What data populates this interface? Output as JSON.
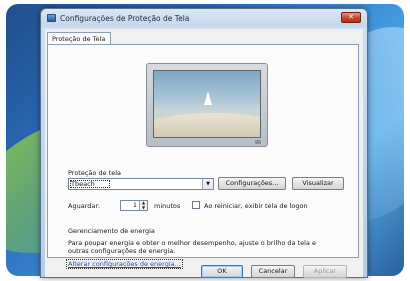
{
  "window": {
    "title": "Configurações de Proteção de Tela",
    "close_glyph": "✕"
  },
  "tabs": [
    {
      "label": "Proteção de Tela"
    }
  ],
  "screensaver": {
    "section_label": "Proteção de tela",
    "selected": "Tbeach",
    "settings_button": "Configurações...",
    "preview_button": "Visualizar",
    "wait_label": "Aguardar:",
    "wait_value": "1",
    "minutes_label": "minutos",
    "resume_checkbox_label": "Ao reiniciar, exibir tela de logon",
    "resume_checked": false
  },
  "power": {
    "section_label": "Gerenciamento de energia",
    "description": "Para poupar energia e obter o melhor desempenho, ajuste o brilho da tela e outras configurações de energia.",
    "link": "Alterar configurações de energia..."
  },
  "footer": {
    "ok": "OK",
    "cancel": "Cancelar",
    "apply": "Aplicar"
  },
  "icons": {
    "dropdown": "chevron-down-icon",
    "spinner": "spinner-arrows-icon",
    "window": "screensaver-app-icon"
  },
  "colors": {
    "link": "#1f4fb0",
    "close_button": "#c9452b"
  }
}
